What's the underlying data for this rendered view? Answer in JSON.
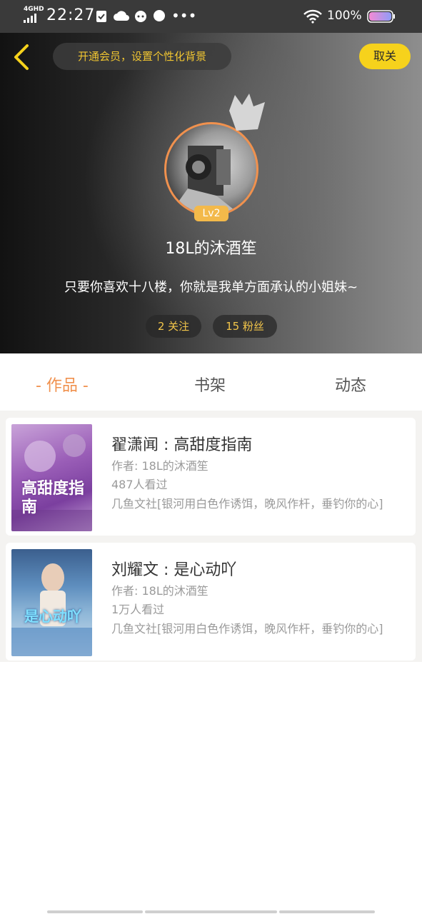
{
  "status_bar": {
    "network": "4GHD",
    "time": "22:27",
    "battery": "100%"
  },
  "header": {
    "vip_prompt": "开通会员，设置个性化背景",
    "cancel_label": "取关"
  },
  "profile": {
    "level": "Lv2",
    "username": "18L的沐酒笙",
    "signature": "只要你喜欢十八楼，你就是我单方面承认的小姐妹~",
    "following": "2 关注",
    "followers": "15 粉丝"
  },
  "tabs": [
    {
      "label": "- 作品 -",
      "active": true
    },
    {
      "label": "书架",
      "active": false
    },
    {
      "label": "动态",
      "active": false
    }
  ],
  "works": [
    {
      "title": "翟潇闻 : 高甜度指南",
      "author": "作者: 18L的沐酒笙",
      "views": "487人看过",
      "desc": "几鱼文社[银河用白色作诱饵，晚风作杆，垂钓你的心]",
      "cover_text": "高甜度指南"
    },
    {
      "title": "刘耀文 : 是心动吖",
      "author": "作者: 18L的沐酒笙",
      "views": "1万人看过",
      "desc": "几鱼文社[银河用白色作诱饵，晚风作杆，垂钓你的心]",
      "cover_text": "是心动吖"
    }
  ],
  "colors": {
    "accent": "#f0914e",
    "gold": "#f6d21c",
    "stat_text": "#f3c64a"
  }
}
